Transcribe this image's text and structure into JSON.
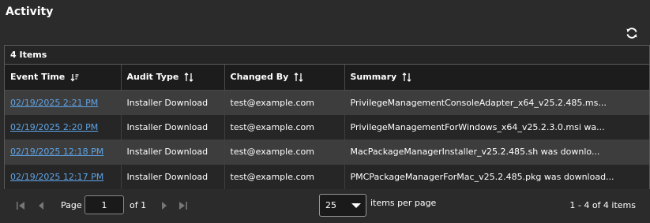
{
  "header": {
    "title": "Activity"
  },
  "grid": {
    "count_label": "4 Items",
    "columns": [
      {
        "label": "Event Time"
      },
      {
        "label": "Audit Type"
      },
      {
        "label": "Changed By"
      },
      {
        "label": "Summary"
      }
    ],
    "rows": [
      {
        "event_time": "02/19/2025 2:21 PM",
        "audit_type": "Installer Download",
        "changed_by": "test@example.com",
        "summary": "PrivilegeManagementConsoleAdapter_x64_v25.2.485.ms..."
      },
      {
        "event_time": "02/19/2025 2:20 PM",
        "audit_type": "Installer Download",
        "changed_by": "test@example.com",
        "summary": "PrivilegeManagementForWindows_x64_v25.2.3.0.msi wa..."
      },
      {
        "event_time": "02/19/2025 12:18 PM",
        "audit_type": "Installer Download",
        "changed_by": "test@example.com",
        "summary": "MacPackageManagerInstaller_v25.2.485.sh was downlo..."
      },
      {
        "event_time": "02/19/2025 12:17 PM",
        "audit_type": "Installer Download",
        "changed_by": "test@example.com",
        "summary": "PMCPackageManagerForMac_v25.2.485.pkg was download..."
      }
    ]
  },
  "pager": {
    "page_label": "Page",
    "page_value": "1",
    "of_label": "of 1",
    "per_page_value": "25",
    "per_page_label": "items per page",
    "range_label": "1 - 4 of 4 items"
  },
  "colors": {
    "background": "#2b2b2b",
    "link": "#5ea4e6",
    "row_odd": "#3d3d3d",
    "row_even": "#262626"
  },
  "icons": {
    "refresh": "refresh-icon",
    "sort_desc": "sort-descending-icon",
    "sort": "sort-icon",
    "first": "first-page-icon",
    "prev": "previous-page-icon",
    "next": "next-page-icon",
    "last": "last-page-icon",
    "dropdown": "chevron-down-icon"
  }
}
